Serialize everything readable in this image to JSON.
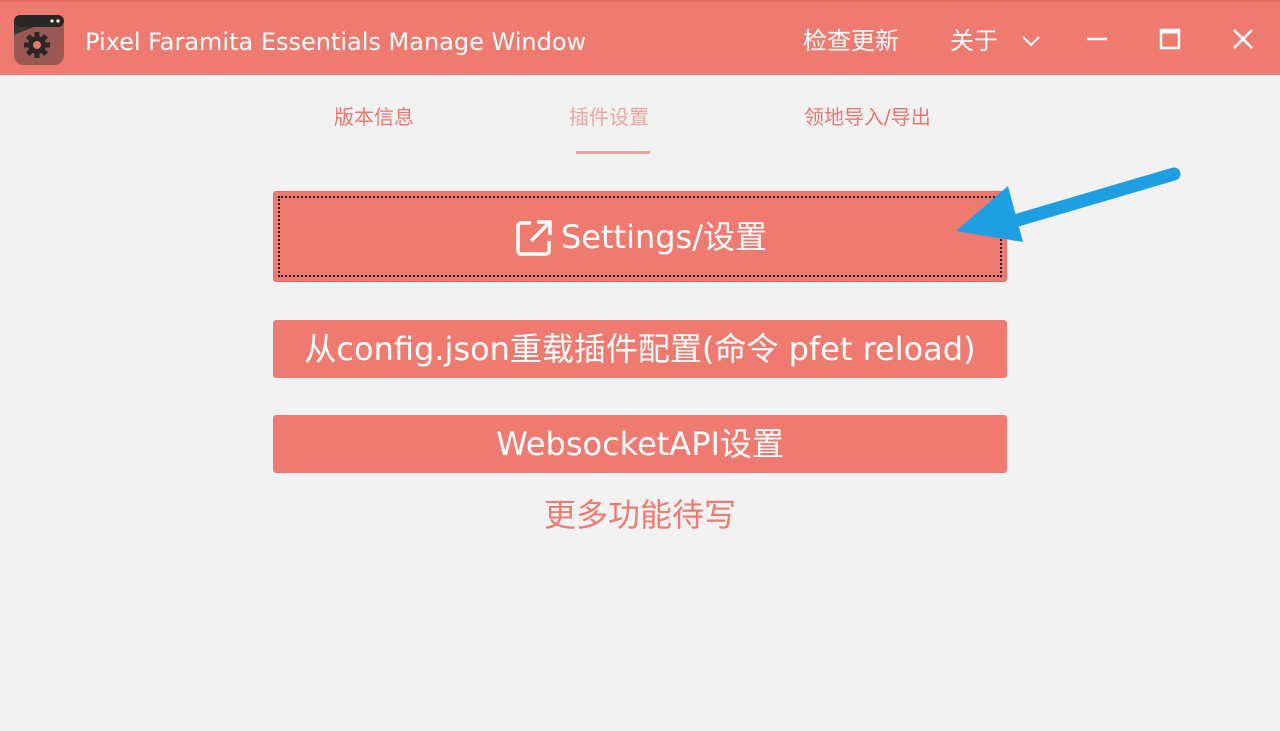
{
  "window": {
    "title": "Pixel Faramita Essentials Manage Window",
    "icon": "app-gear-icon",
    "menu": {
      "check_update": "检查更新",
      "about": "关于"
    },
    "controls": {
      "minimize": "minimize-icon",
      "maximize": "maximize-icon",
      "close": "close-icon"
    }
  },
  "tabs": [
    {
      "label": "版本信息",
      "active": false
    },
    {
      "label": "插件设置",
      "active": true
    },
    {
      "label": "领地导入/导出",
      "active": false
    }
  ],
  "buttons": {
    "settings": {
      "label": "Settings/设置",
      "icon": "external-link-icon"
    },
    "reload": {
      "label": "从config.json重载插件配置(命令 pfet reload)"
    },
    "websocket": {
      "label": "WebsocketAPI设置"
    }
  },
  "more_text": "更多功能待写",
  "colors": {
    "accent": "#ef7b70",
    "background": "#f3f2f2",
    "tab_active": "#efa49c",
    "annotation_arrow": "#1e9ee3"
  }
}
